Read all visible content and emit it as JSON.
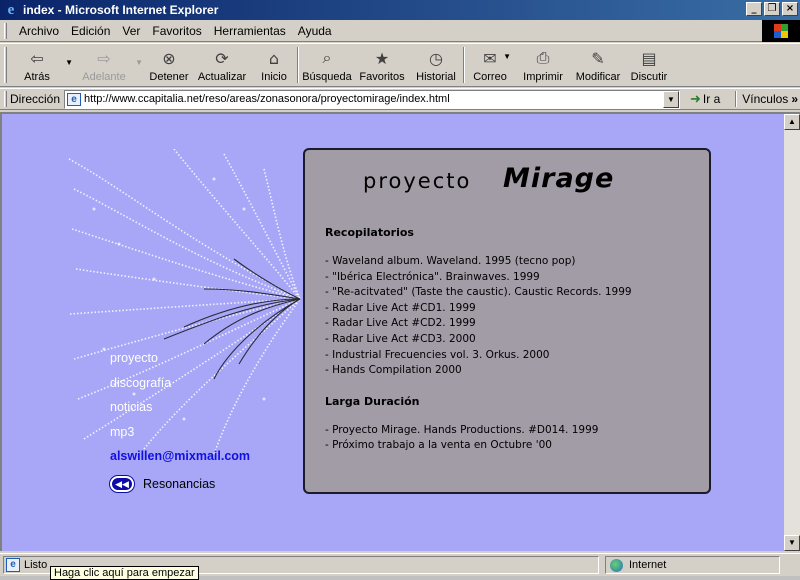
{
  "window": {
    "title": "index - Microsoft Internet Explorer"
  },
  "menu": [
    "Archivo",
    "Edición",
    "Ver",
    "Favoritos",
    "Herramientas",
    "Ayuda"
  ],
  "toolbar": {
    "back": "Atrás",
    "forward": "Adelante",
    "stop": "Detener",
    "refresh": "Actualizar",
    "home": "Inicio",
    "search": "Búsqueda",
    "favorites": "Favoritos",
    "history": "Historial",
    "mail": "Correo",
    "print": "Imprimir",
    "edit": "Modificar",
    "discuss": "Discutir"
  },
  "address": {
    "label": "Dirección",
    "url": "http://www.ccapitalia.net/reso/areas/zonasonora/proyectomirage/index.html",
    "go": "Ir a",
    "links": "Vínculos"
  },
  "page": {
    "logo": {
      "prefix": "proyecto",
      "name": "Mirage"
    },
    "nav": [
      "proyecto",
      "discografía",
      "noticias",
      "mp3"
    ],
    "email": "alswillen@mixmail.com",
    "back_link": "Resonancias",
    "sections": [
      {
        "title": "Recopilatorios",
        "items": [
          "- Waveland album. Waveland. 1995 (tecno pop)",
          "- \"Ibérica Electrónica\". Brainwaves. 1999",
          "- \"Re-acitvated\" (Taste the caustic). Caustic Records. 1999",
          "- Radar Live Act #CD1. 1999",
          "- Radar Live Act #CD2. 1999",
          "- Radar Live Act #CD3. 2000",
          "- Industrial Frecuencies vol. 3. Orkus. 2000",
          "- Hands Compilation 2000"
        ]
      },
      {
        "title": "Larga Duración",
        "items": [
          "- Proyecto Mirage. Hands Productions. #D014. 1999",
          "- Próximo trabajo a la venta en Octubre '00"
        ]
      }
    ],
    "background_color": "#a8a6f7",
    "panel_color": "#a29ca7"
  },
  "status": {
    "text": "Listo",
    "zone": "Internet",
    "tooltip": "Haga clic aquí para empezar"
  }
}
